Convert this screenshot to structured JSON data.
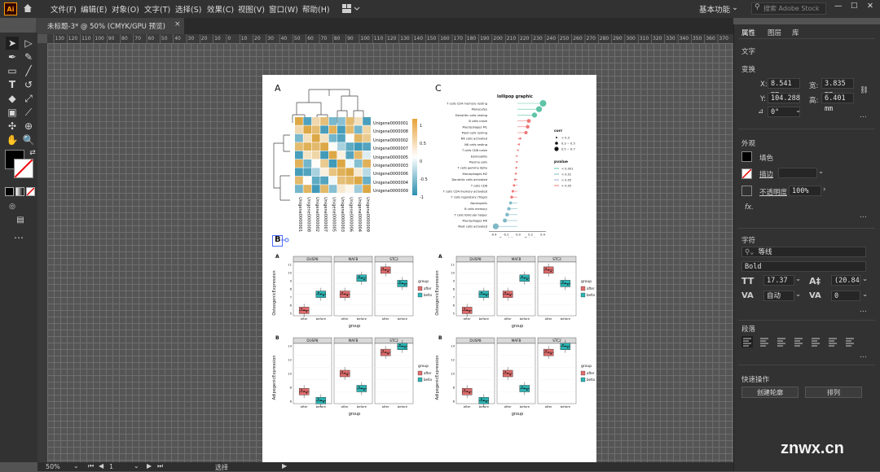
{
  "app": {
    "logo": "Ai"
  },
  "menu": [
    "文件(F)",
    "编辑(E)",
    "对象(O)",
    "文字(T)",
    "选择(S)",
    "效果(C)",
    "视图(V)",
    "窗口(W)",
    "帮助(H)"
  ],
  "workspace": {
    "label": "基本功能",
    "search_placeholder": "搜索 Adobe Stock"
  },
  "document_tab": {
    "title": "未标题-3* @ 50% (CMYK/GPU 预览)",
    "close": "×"
  },
  "ruler_ticks": [
    "130",
    "120",
    "110",
    "100",
    "90",
    "80",
    "70",
    "60",
    "50",
    "40",
    "30",
    "20",
    "10",
    "0",
    "10",
    "20",
    "30",
    "40",
    "50",
    "60",
    "70",
    "80",
    "90",
    "100",
    "110",
    "120",
    "130",
    "140",
    "150",
    "160",
    "170",
    "180",
    "190",
    "200",
    "210",
    "220",
    "230",
    "240",
    "250",
    "260",
    "270",
    "280",
    "290",
    "300",
    "310",
    "320",
    "330",
    "340",
    "350",
    "360",
    "370"
  ],
  "status": {
    "zoom": "50%",
    "page": "1",
    "tool": "选择"
  },
  "panel": {
    "tabs": [
      "属性",
      "图层",
      "库"
    ],
    "section_type": "文字",
    "transform": {
      "title": "变换",
      "x_label": "X:",
      "x": "8.541 mm",
      "w_label": "宽:",
      "w": "3.835 mm",
      "y_label": "Y:",
      "y": "104.288",
      "h_label": "高:",
      "h": "6.401 mm",
      "angle": "0°"
    },
    "appearance": {
      "title": "外观",
      "fill": "填色",
      "stroke": "描边",
      "opacity_label": "不透明度",
      "opacity": "100%",
      "fx": "fx."
    },
    "character": {
      "title": "字符",
      "font": "等线",
      "style": "Bold",
      "size": "17.37",
      "leading": "(20.84",
      "kerning": "自动",
      "tracking": "0"
    },
    "paragraph": {
      "title": "段落"
    },
    "quick_actions": {
      "title": "快速操作",
      "btn1": "创建轮廓",
      "btn2": "排列"
    }
  },
  "artwork": {
    "heatmap": {
      "panel_label": "A",
      "legend_ticks": [
        "1",
        "0.5",
        "0",
        "-0.5",
        "-1"
      ],
      "rows": [
        "Unigene0000001",
        "Unigene0000008",
        "Unigene0000002",
        "Unigene0000007",
        "Unigene0000005",
        "Unigene0000003",
        "Unigene0000006",
        "Unigene0000004",
        "Unigene0000009"
      ]
    },
    "lollipop": {
      "panel_label": "C",
      "title": "lollipop graphic",
      "xlabel": "Correlation coefficient",
      "x_ticks": [
        "-0.4",
        "-0.2",
        "0.0",
        "0.2",
        "0.4"
      ],
      "cells": [
        "T cells CD4 memory resting",
        "Monocytes",
        "Dendritic cells resting",
        "B cells naive",
        "Macrophages M1",
        "Mast cells resting",
        "NK cells activated",
        "NK cells resting",
        "T cells CD8 naive",
        "Eosinophils",
        "Plasma cells",
        "T cells gamma delta",
        "Macrophages M2",
        "Dendritic cells activated",
        "T cells CD8",
        "T cells CD4 memory activated",
        "T cells regulatory (Tregs)",
        "Neutrophils",
        "B cells memory",
        "T cells follicular helper",
        "Macrophages M0",
        "Mast cells activated"
      ],
      "cor_values": [
        0.45,
        0.38,
        0.3,
        0.2,
        0.18,
        0.15,
        0.05,
        0.03,
        0.01,
        -0.01,
        -0.01,
        -0.02,
        -0.03,
        -0.04,
        -0.06,
        -0.08,
        -0.1,
        -0.12,
        -0.15,
        -0.18,
        -0.22,
        -0.38
      ],
      "legend_cor_title": "corr",
      "legend_cor": [
        "< 0.3",
        "0.3 ~ 0.5",
        "0.5 ~ 0.7"
      ],
      "legend_p_title": "pvalue",
      "legend_p": [
        "< 0.001",
        "< 0.01",
        "< 0.05",
        "> 0.05"
      ]
    },
    "selected_text": "B",
    "boxplots": {
      "genes": [
        "DUSP8",
        "MAFB",
        "STC2"
      ],
      "groups": [
        "after",
        "before"
      ],
      "legend_title": "group",
      "xlabel": "group",
      "top_ylabel": "OsteogenicExpression",
      "bottom_ylabel": "AdipogenicExpression",
      "top_label": "A",
      "bottom_label": "B",
      "top_yticks": [
        "11",
        "10",
        "9",
        "8",
        "7",
        "6",
        "5"
      ],
      "bottom_yticks": [
        "14",
        "12",
        "10",
        "8",
        "6"
      ]
    }
  },
  "watermark": "znwx.cn",
  "colors": {
    "after": "#e06b6b",
    "before": "#2cb3b3",
    "heat_high": "#e8a23a",
    "heat_low": "#2b8fb0"
  }
}
